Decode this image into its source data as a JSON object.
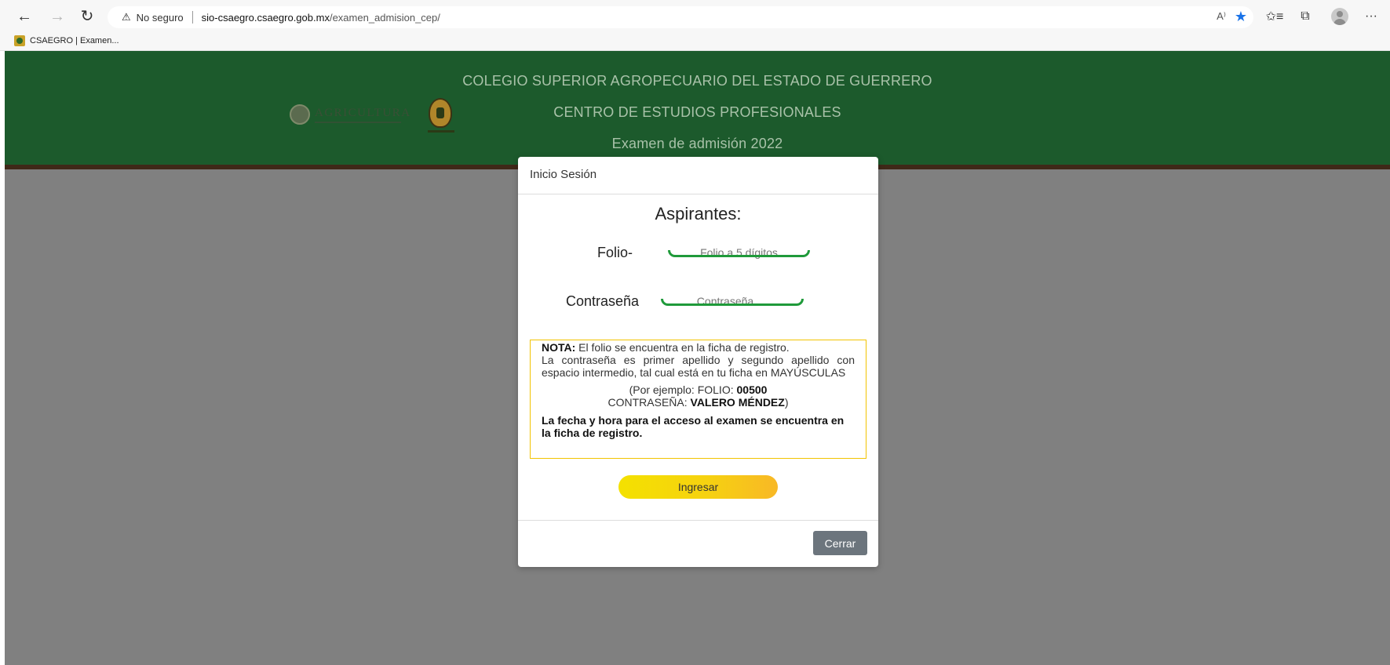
{
  "browser": {
    "nav": {
      "back_icon": "←",
      "forward_icon": "→",
      "refresh_icon": "↻"
    },
    "address": {
      "warning_icon": "⚠",
      "security_text": "No seguro",
      "url_host": "sio-csaegro.csaegro.gob.mx",
      "url_path": "/examen_admision_cep/"
    },
    "read_aloud_icon": "A⁾",
    "favorite_icon": "★",
    "toolbar_icons": {
      "favorites": "✩≡",
      "collections": "⧉",
      "more": "···"
    },
    "bookmarks": [
      {
        "label": "CSAEGRO | Examen..."
      }
    ]
  },
  "header": {
    "line1": "COLEGIO SUPERIOR AGROPECUARIO DEL ESTADO DE GUERRERO",
    "line2": "CENTRO DE ESTUDIOS PROFESIONALES",
    "line3": "Examen de admisión 2022",
    "agri_logo_text": "AGRICULTURA"
  },
  "modal": {
    "title": "Inicio Sesión",
    "heading": "Aspirantes:",
    "folio_label": "Folio-",
    "folio_placeholder": "Folio a 5 dígitos",
    "password_label": "Contraseña",
    "password_placeholder": "Contraseña",
    "note": {
      "lead": "NOTA:",
      "line1": " El folio se encuentra en la ficha de registro.",
      "body": "La contraseña es primer apellido y segundo apellido con espacio intermedio, tal cual está en tu ficha en MAYÚSCULAS",
      "example_folio_prefix": "(Por ejemplo: FOLIO: ",
      "example_folio_value": "00500",
      "example_pass_prefix": "CONTRASEÑA: ",
      "example_pass_value": "VALERO MÉNDEZ",
      "example_pass_suffix": ")",
      "access": "La fecha y hora para el acceso al examen se encuentra en la ficha de registro."
    },
    "login_button": "Ingresar",
    "close_button": "Cerrar"
  },
  "colors": {
    "header_green": "#1c5a2c",
    "input_underline": "#1f9a3a",
    "note_border": "#f2c300",
    "close_button": "#6c757d"
  }
}
